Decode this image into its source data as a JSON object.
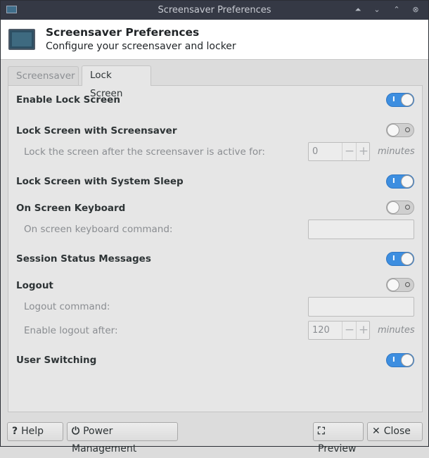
{
  "window": {
    "title": "Screensaver Preferences",
    "buttons": {
      "shade": "⏶",
      "minimize": "⌄",
      "maximize": "⌃",
      "close": "⊗"
    }
  },
  "header": {
    "title": "Screensaver Preferences",
    "subtitle": "Configure your screensaver and locker",
    "icon": "monitor-icon"
  },
  "tabs": [
    {
      "label": "Screensaver",
      "active": false
    },
    {
      "label": "Lock Screen",
      "active": true
    }
  ],
  "settings": {
    "enable_lock": {
      "label": "Enable Lock Screen",
      "on": true
    },
    "lock_with_saver": {
      "label": "Lock Screen with Screensaver",
      "on": false,
      "delay_label": "Lock the screen after the screensaver is active for:",
      "delay_value": "0",
      "delay_unit": "minutes"
    },
    "lock_with_sleep": {
      "label": "Lock Screen with System Sleep",
      "on": true
    },
    "osk": {
      "label": "On Screen Keyboard",
      "on": false,
      "command_label": "On screen keyboard command:",
      "command_value": ""
    },
    "status_messages": {
      "label": "Session Status Messages",
      "on": true
    },
    "logout": {
      "label": "Logout",
      "on": false,
      "command_label": "Logout command:",
      "command_value": "",
      "after_label": "Enable logout after:",
      "after_value": "120",
      "after_unit": "minutes"
    },
    "user_switching": {
      "label": "User Switching",
      "on": true
    }
  },
  "footer": {
    "help": {
      "icon": "?",
      "label": "Help"
    },
    "power": {
      "icon": "⏻",
      "label": "Power Management"
    },
    "preview": {
      "icon": "⛶",
      "label": "Preview"
    },
    "close": {
      "icon": "✕",
      "label": "Close"
    }
  },
  "colors": {
    "accent": "#3d8ee0",
    "titlebar": "#353945"
  }
}
